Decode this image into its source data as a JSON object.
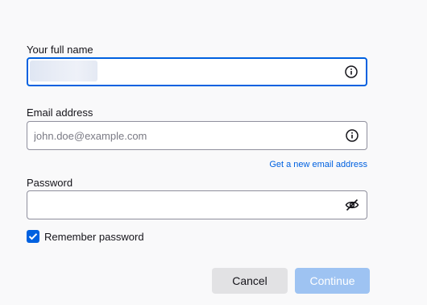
{
  "form": {
    "name": {
      "label": "Your full name",
      "value": "",
      "placeholder": "",
      "icon": "info-icon"
    },
    "email": {
      "label": "Email address",
      "value": "",
      "placeholder": "john.doe@example.com",
      "icon": "info-icon",
      "link": "Get a new email address"
    },
    "password": {
      "label": "Password",
      "value": "",
      "icon": "eye-slash-icon"
    },
    "remember": {
      "label": "Remember password",
      "checked": true
    },
    "buttons": {
      "cancel": "Cancel",
      "continue": "Continue"
    }
  },
  "colors": {
    "accent": "#0061e0",
    "continue_disabled": "#9ec3f2",
    "cancel_bg": "#e2e2e4",
    "page_bg": "#f9f9fa"
  }
}
